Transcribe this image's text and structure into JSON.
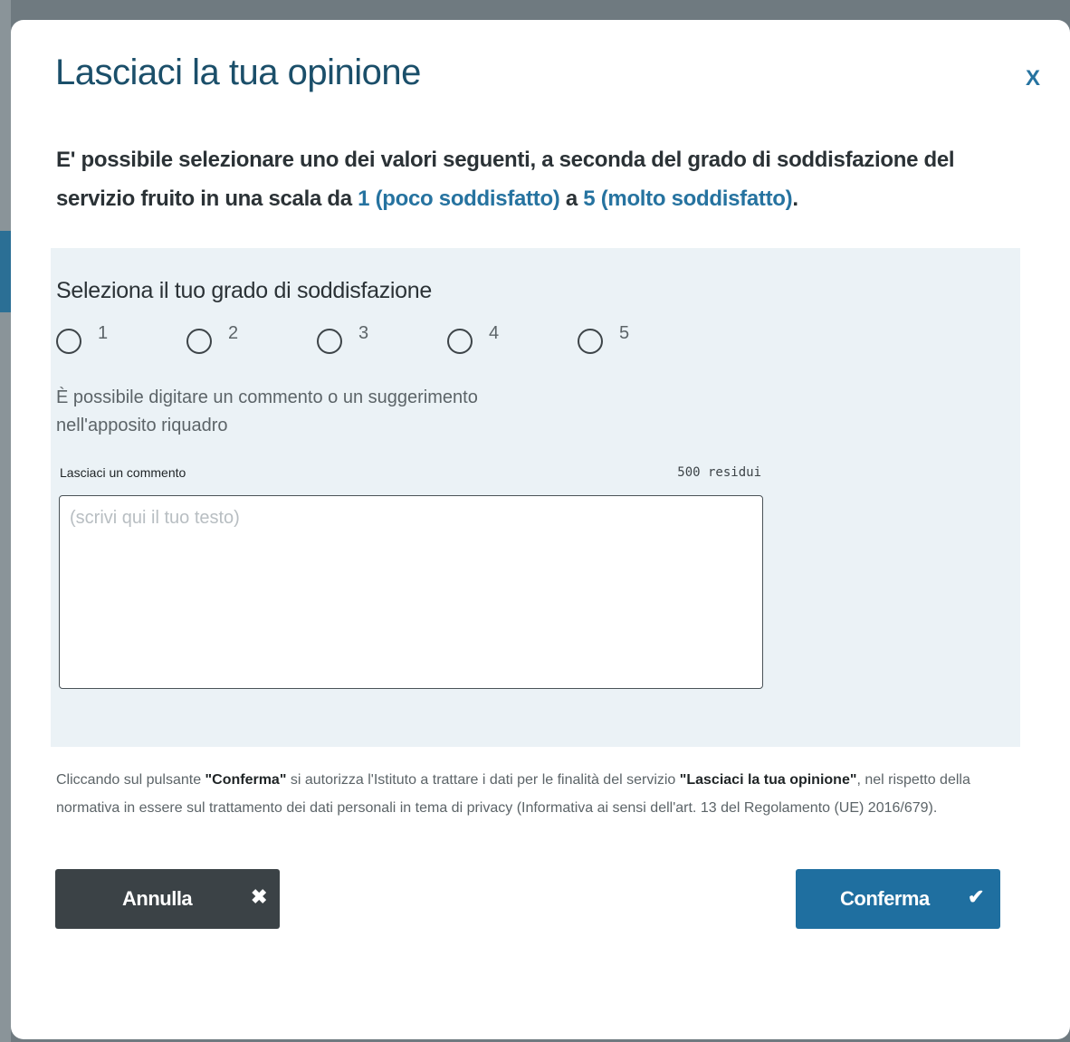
{
  "dialog": {
    "title": "Lasciaci la tua opinione",
    "close_label": "X",
    "intro": {
      "text_before": "E' possibile selezionare uno dei valori seguenti, a seconda del grado di soddisfazione del servizio fruito in una scala da ",
      "low_value": "1 (poco soddisfatto)",
      "middle": " a ",
      "high_value": "5 (molto soddisfatto)",
      "end": "."
    },
    "colors": {
      "title": "#1b4f6a",
      "accent": "#2673a0",
      "panel_background": "#ebf2f6",
      "cancel_button": "#3b4246",
      "confirm_button": "#1f6fa0"
    }
  },
  "rating": {
    "heading": "Seleziona il tuo grado di soddisfazione",
    "options": [
      "1",
      "2",
      "3",
      "4",
      "5"
    ],
    "selected": null
  },
  "comment": {
    "hint": "È possibile digitare un commento o un suggerimento nell'apposito riquadro",
    "label": "Lasciaci un commento",
    "counter": "500 residui",
    "placeholder": "(scrivi qui il tuo testo)",
    "value": ""
  },
  "privacy": {
    "part1": "Cliccando sul pulsante ",
    "confirm_ref": "\"Conferma\"",
    "part2": " si autorizza l'Istituto a trattare i dati per le finalità del servizio ",
    "service_ref": "\"Lasciaci la tua opinione\"",
    "part3": ", nel rispetto della normativa in essere sul trattamento dei dati personali in tema di privacy (Informativa ai sensi dell'art. 13 del Regolamento (UE) 2016/679)."
  },
  "actions": {
    "cancel_label": "Annulla",
    "cancel_icon": "close-x-icon",
    "confirm_label": "Conferma",
    "confirm_icon": "checkmark-icon"
  }
}
